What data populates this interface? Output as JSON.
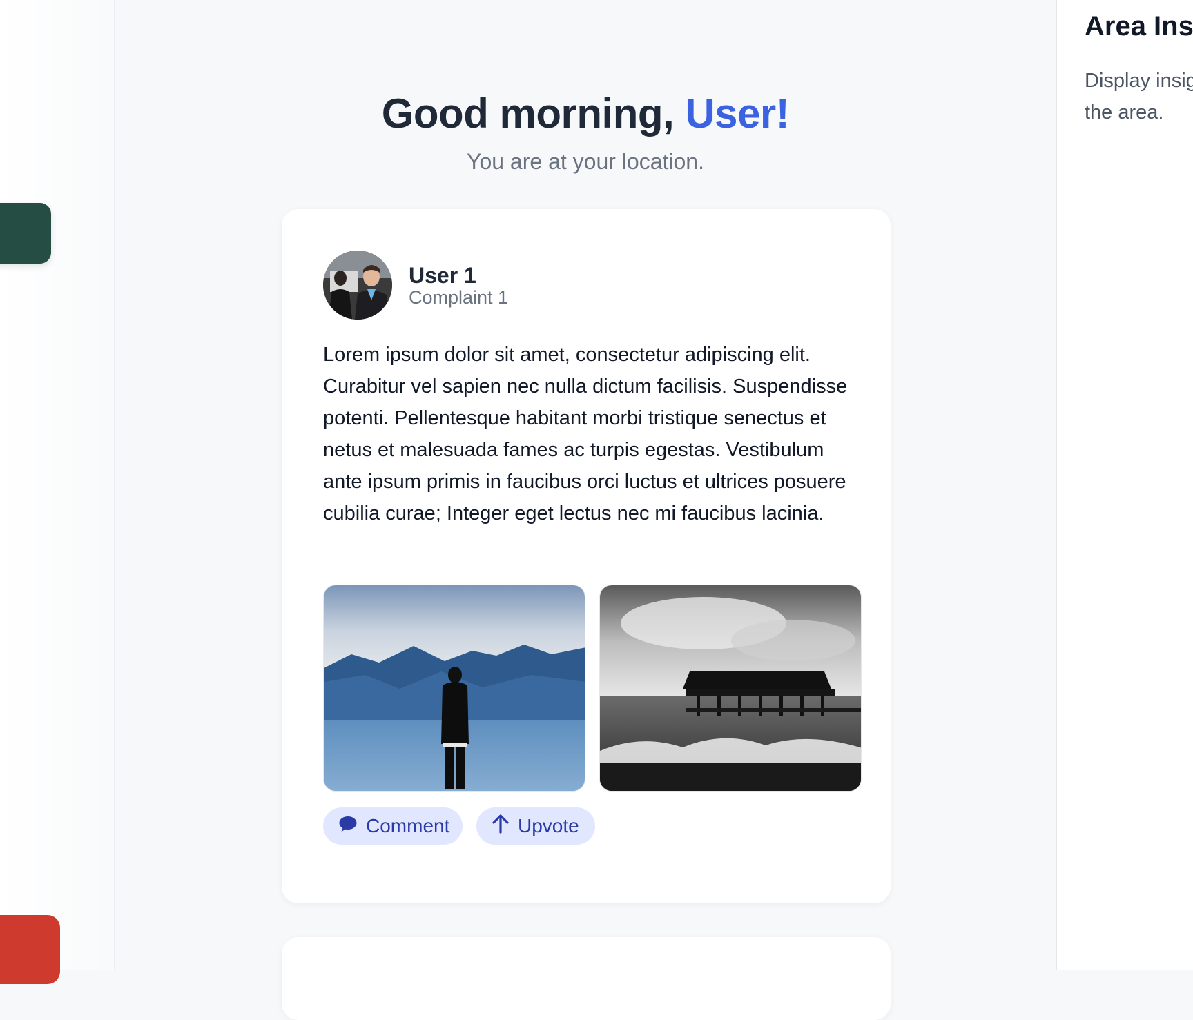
{
  "greeting": {
    "prefix": "Good morning, ",
    "name": "User!"
  },
  "subtitle": "You are at your location.",
  "post": {
    "user_name": "User 1",
    "subtitle": "Complaint 1",
    "text": "Lorem ipsum dolor sit amet, consectetur adipiscing elit. Curabitur vel sapien nec nulla dictum facilisis. Suspendisse potenti. Pellentesque habitant morbi tristique senectus et netus et malesuada fames ac turpis egestas. Vestibulum ante ipsum primis in faucibus orci luctus et ultrices posuere cubilia curae; Integer eget lectus nec mi faucibus lacinia.",
    "actions": {
      "comment": "Comment",
      "upvote": "Upvote"
    }
  },
  "right_panel": {
    "title": "Area Insights",
    "description": "Display insights to users about the area."
  },
  "colors": {
    "accent": "#3b62e0",
    "sidebar_dark": "#254d43",
    "sidebar_red": "#cf3a2f",
    "action_bg": "#e0e7ff",
    "action_text": "#2a3aa6"
  }
}
